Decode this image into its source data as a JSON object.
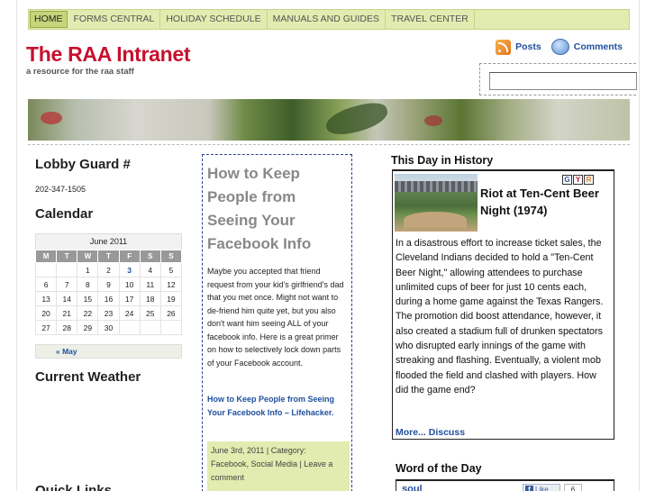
{
  "nav": {
    "items": [
      {
        "label": "HOME",
        "active": true
      },
      {
        "label": "FORMS CENTRAL",
        "active": false
      },
      {
        "label": "HOLIDAY SCHEDULE",
        "active": false
      },
      {
        "label": "MANUALS AND GUIDES",
        "active": false
      },
      {
        "label": "TRAVEL CENTER",
        "active": false
      }
    ]
  },
  "header": {
    "title": "The RAA Intranet",
    "tagline": "a resource for the raa staff",
    "posts_label": "Posts",
    "comments_label": "Comments",
    "search_value": ""
  },
  "sidebar": {
    "lobby_title": "Lobby Guard #",
    "lobby_phone": "202-347-1505",
    "calendar_title": "Calendar",
    "calendar": {
      "month": "June 2011",
      "weekdays": [
        "M",
        "T",
        "W",
        "T",
        "F",
        "S",
        "S"
      ],
      "weeks": [
        [
          "",
          "",
          "1",
          "2",
          "3",
          "4",
          "5"
        ],
        [
          "6",
          "7",
          "8",
          "9",
          "10",
          "11",
          "12"
        ],
        [
          "13",
          "14",
          "15",
          "16",
          "17",
          "18",
          "19"
        ],
        [
          "20",
          "21",
          "22",
          "23",
          "24",
          "25",
          "26"
        ],
        [
          "27",
          "28",
          "29",
          "30",
          "",
          "",
          ""
        ]
      ],
      "today": "3",
      "prev_link": "« May"
    },
    "weather_title": "Current Weather",
    "quick_links_title": "Quick Links"
  },
  "post": {
    "title": "How to Keep People from Seeing Your Facebook Info",
    "body": "Maybe you accepted that friend request from your kid's girlfriend's dad that you met once. Might not want to de-friend him quite yet, but you also don't want him seeing ALL of your facebook info. Here is a great primer on how to selectively lock down parts of your Facebook account.",
    "link": "How to Keep People from Seeing Your Facebook Info – Lifehacker.",
    "meta": "June 3rd, 2011 | Category: Facebook, Social Media | Leave a comment"
  },
  "history": {
    "title": "This Day in History",
    "badges": [
      "G",
      "Y",
      "R"
    ],
    "headline": "Riot at Ten-Cent Beer Night (1974)",
    "text": "In a disastrous effort to increase ticket sales, the Cleveland Indians decided to hold a \"Ten-Cent Beer Night,\" allowing attendees to purchase unlimited cups of beer for just 10 cents each, during a home game against the Texas Rangers. The promotion did boost attendance, however, it also created a stadium full of drunken spectators who disrupted early innings of the game with streaking and flashing. Eventually, a violent mob flooded the field and clashed with players. How did the game end?",
    "more_label": "More... Discuss"
  },
  "wotd": {
    "title": "Word of the Day",
    "word": "soul",
    "like_label": "Like",
    "like_count": "6"
  }
}
